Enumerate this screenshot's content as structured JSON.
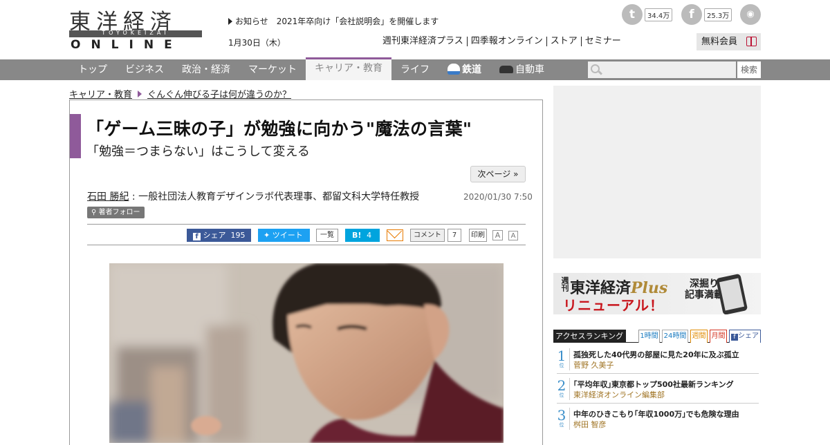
{
  "logo": {
    "main": "東洋経済",
    "band": "TOYOKEIZAI",
    "sub": "ONLINE"
  },
  "header": {
    "notice": "お知らせ　2021年卒向け「会社説明会」を開催します",
    "date": "1月30日（木）",
    "links": [
      "週刊東洋経済プラス",
      "四季報オンライン",
      "ストア",
      "セミナー"
    ],
    "member_button": "無料会員",
    "twitter_count": "34.4万",
    "facebook_count": "25.3万"
  },
  "nav": {
    "items": [
      "トップ",
      "ビジネス",
      "政治・経済",
      "マーケット",
      "キャリア・教育",
      "ライフ",
      "鉄道",
      "自動車"
    ],
    "active_index": 4,
    "search_button": "検索",
    "search_placeholder": ""
  },
  "breadcrumb": {
    "section": "キャリア・教育",
    "series": "ぐんぐん伸びる子は何が違うのか？"
  },
  "article": {
    "title": "「ゲーム三昧の子」が勉強に向かう\"魔法の言葉\"",
    "subtitle": "「勉強＝つまらない」はこうして変える",
    "next_page": "次ページ »",
    "author_name": "石田 勝紀",
    "author_desc": " : 一般社団法人教育デザインラボ代表理事、都留文科大学特任教授",
    "follow": "著者フォロー",
    "date": "2020/01/30 7:50",
    "share": {
      "facebook_label": "シェア",
      "facebook_count": "195",
      "tweet_label": "ツイート",
      "list_label": "一覧",
      "hatena_label": "B!",
      "hatena_count": "4",
      "comment_label": "コメント",
      "comment_count": "7",
      "print_label": "印刷",
      "font_large": "A",
      "font_small": "A"
    }
  },
  "sidebar": {
    "promo": {
      "brand_small": "週刊",
      "brand": "東洋経済",
      "plus": "Plus",
      "headline": "リニューアル！",
      "tagline_1": "深掘り",
      "tagline_2": "記事満載"
    },
    "ranking": {
      "title": "アクセスランキング",
      "tabs": [
        "1時間",
        "24時間",
        "週間",
        "月間",
        "シェア"
      ],
      "rank_suffix": "位",
      "items": [
        {
          "rank": "1",
          "title": "孤独死した40代男の部屋に見た20年に及ぶ孤立",
          "author": "菅野 久美子"
        },
        {
          "rank": "2",
          "title": "｢平均年収｣東京都トップ500社最新ランキング",
          "author": "東洋経済オンライン編集部"
        },
        {
          "rank": "3",
          "title": "中年のひきこもり｢年収1000万｣でも危険な理由",
          "author": "桝田 智彦"
        }
      ]
    }
  }
}
